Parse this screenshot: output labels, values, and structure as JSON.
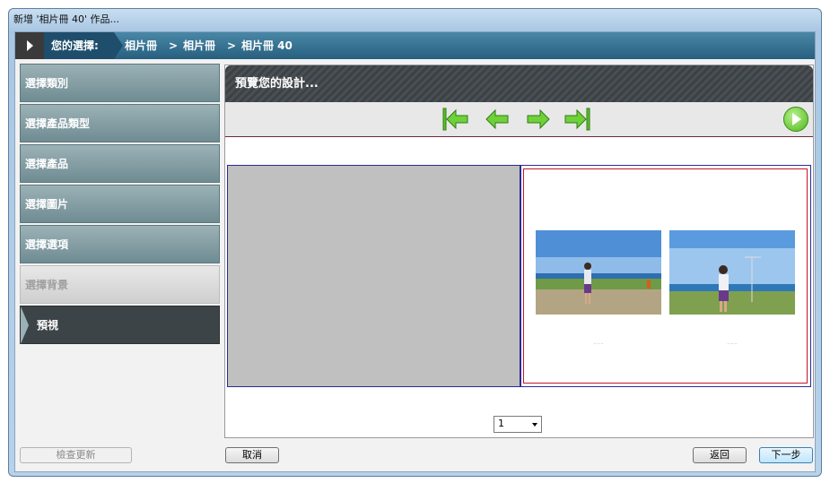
{
  "window": {
    "title": "新增 '相片冊 40' 作品..."
  },
  "breadcrumb": {
    "label": "您的選擇:",
    "items": [
      "相片冊",
      "相片冊",
      "相片冊 40"
    ],
    "separator": ">"
  },
  "sidebar": {
    "items": [
      {
        "label": "選擇類別"
      },
      {
        "label": "選擇產品類型"
      },
      {
        "label": "選擇產品"
      },
      {
        "label": "選擇圖片"
      },
      {
        "label": "選擇選項"
      },
      {
        "label": "選擇背景"
      },
      {
        "label": "預視"
      }
    ]
  },
  "preview": {
    "title": "預覽您的設計...",
    "page_select_value": "1",
    "nav_icons": [
      "first-page-icon",
      "prev-page-icon",
      "next-page-icon",
      "last-page-icon",
      "play-icon"
    ]
  },
  "footer": {
    "check_update_label": "檢查更新",
    "cancel_label": "取消",
    "back_label": "返回",
    "next_label": "下一步"
  },
  "colors": {
    "breadcrumb_bar": "#275f7f",
    "sidebar_item": "#7d979d",
    "sidebar_active": "#3d4448",
    "preview_header": "#44494d",
    "nav_arrow": "#5cc12b",
    "page_border": "#2a2a9a",
    "page_inner_border": "#c4172c"
  }
}
